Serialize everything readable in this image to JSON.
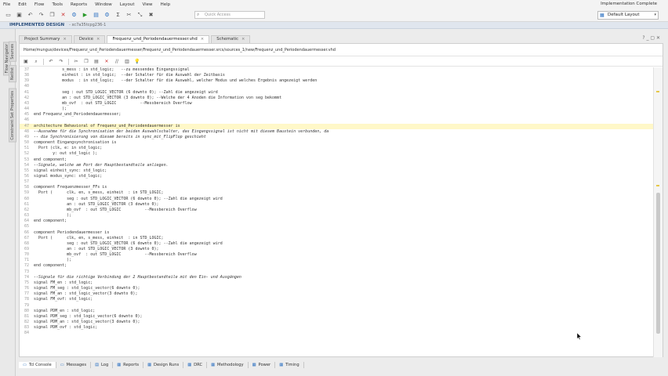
{
  "menu": {
    "items": [
      "File",
      "Edit",
      "Flow",
      "Tools",
      "Reports",
      "Window",
      "Layout",
      "View",
      "Help"
    ],
    "status": "Implementation Complete"
  },
  "toolbar": {
    "quick_access_placeholder": "Quick Access",
    "layout_value": "Default Layout"
  },
  "flow": {
    "title": "IMPLEMENTED DESIGN",
    "subtitle": "- xc7a35tcpg236-1"
  },
  "left_rail": {
    "tabs": [
      "Flow Navigator",
      "Sources",
      "Netlist",
      "Constraint Set Properties"
    ]
  },
  "editor_tabs": [
    {
      "label": "Project Summary",
      "active": false
    },
    {
      "label": "Device",
      "active": false
    },
    {
      "label": "Frequenz_und_Periodendauermesser.vhd",
      "active": true
    },
    {
      "label": "Schematic",
      "active": false
    }
  ],
  "editor": {
    "path": "Home/mungus/devices/Frequenz_und_Periodendauermesser/Frequenz_und_Periodendauermesser.srcs/sources_1/new/Frequenz_und_Periodendauermesser.vhd",
    "lines": [
      {
        "n": "37",
        "t": "            s_mess : in std_logic;   --zu messendes Eingangssignal",
        "hl": false
      },
      {
        "n": "38",
        "t": "            einheit : in std_logic;  --der Schalter für die Auswahl der Zeitbasis",
        "hl": false
      },
      {
        "n": "39",
        "t": "            modus  : in std_logic;   --der Schalter für die Auswahl, welcher Modus und welches Ergebnis angezeigt werden",
        "hl": false
      },
      {
        "n": "40",
        "t": "",
        "hl": false
      },
      {
        "n": "41",
        "t": "            seg : out STD_LOGIC_VECTOR (6 downto 0); --Zahl die angezeigt wird",
        "hl": false
      },
      {
        "n": "42",
        "t": "            an : out STD_LOGIC_VECTOR (3 downto 0); --Welche der 4 Anoden die Information von seg bekommt",
        "hl": false
      },
      {
        "n": "43",
        "t": "            mb_ovf  : out STD_LOGIC          --Messbereich Overflow",
        "hl": false
      },
      {
        "n": "44",
        "t": "            );",
        "hl": false
      },
      {
        "n": "45",
        "t": "end Frequenz_und_Periodendauermesser;",
        "hl": false
      },
      {
        "n": "46",
        "t": "",
        "hl": false
      },
      {
        "n": "47",
        "t": "architecture Behavioral of Frequenz_und_Periodendauermesser is",
        "hl": true
      },
      {
        "n": "48",
        "t": "--Ausnahme für die Synchronisation der beiden Auswahlschalter, das Eingangssignal ist nicht mit diesem Baustein verbunden, da",
        "hl": false
      },
      {
        "n": "49",
        "t": "-- die Synchronisierung von diesem bereits in sync_mit_FlipFlop geschieht",
        "hl": false
      },
      {
        "n": "50",
        "t": "component Eingangsynchronisation is",
        "hl": false
      },
      {
        "n": "51",
        "t": "  Port (clk, e: in std_logic;",
        "hl": false
      },
      {
        "n": "52",
        "t": "        y: out std_logic );",
        "hl": false
      },
      {
        "n": "53",
        "t": "end component;",
        "hl": false
      },
      {
        "n": "54",
        "t": "--Signale, welche am Port der Hauptbestandteile anliegen.",
        "hl": false
      },
      {
        "n": "55",
        "t": "signal einheit_sync: std_logic;",
        "hl": false
      },
      {
        "n": "56",
        "t": "signal modus_sync: std_logic;",
        "hl": false
      },
      {
        "n": "57",
        "t": "",
        "hl": false
      },
      {
        "n": "58",
        "t": "component Frequenzmesser_FFs is",
        "hl": false
      },
      {
        "n": "59",
        "t": "  Port (      clk, en, s_mess, einheit  : in STD_LOGIC;",
        "hl": false
      },
      {
        "n": "60",
        "t": "              seg : out STD_LOGIC_VECTOR (6 downto 0); --Zahl die angezeigt wird",
        "hl": false
      },
      {
        "n": "61",
        "t": "              an : out STD_LOGIC_VECTOR (3 downto 0);",
        "hl": false
      },
      {
        "n": "62",
        "t": "              mb_ovf  : out STD_LOGIC          --Messbereich Overflow",
        "hl": false
      },
      {
        "n": "63",
        "t": "              );",
        "hl": false
      },
      {
        "n": "64",
        "t": "end component;",
        "hl": false
      },
      {
        "n": "65",
        "t": "",
        "hl": false
      },
      {
        "n": "66",
        "t": "component Periodendauermesser is",
        "hl": false
      },
      {
        "n": "67",
        "t": "  Port (      clk, en, s_mess, einheit  : in STD_LOGIC;",
        "hl": false
      },
      {
        "n": "68",
        "t": "              seg : out STD_LOGIC_VECTOR (6 downto 0); --Zahl die angezeigt wird",
        "hl": false
      },
      {
        "n": "69",
        "t": "              an : out STD_LOGIC_VECTOR (3 downto 0);",
        "hl": false
      },
      {
        "n": "70",
        "t": "              mb_ovf  : out STD_LOGIC          --Messbereich Overflow",
        "hl": false
      },
      {
        "n": "71",
        "t": "              );",
        "hl": false
      },
      {
        "n": "72",
        "t": "end component;",
        "hl": false
      },
      {
        "n": "73",
        "t": "",
        "hl": false
      },
      {
        "n": "74",
        "t": "--Signale für die richtige Verbindung der 2 Hauptbestandteile mit den Ein- und Ausgängen",
        "hl": false
      },
      {
        "n": "75",
        "t": "signal FM_en : std_logic;",
        "hl": false
      },
      {
        "n": "76",
        "t": "signal FM_seg : std_logic_vector(6 downto 0);",
        "hl": false
      },
      {
        "n": "77",
        "t": "signal FM_an : std_logic_vector(3 downto 0);",
        "hl": false
      },
      {
        "n": "78",
        "t": "signal FM_ovf: std_logic;",
        "hl": false
      },
      {
        "n": "79",
        "t": "",
        "hl": false
      },
      {
        "n": "80",
        "t": "signal PDM_en : std_logic;",
        "hl": false
      },
      {
        "n": "81",
        "t": "signal PDM_seg : std_logic_vector(6 downto 0);",
        "hl": false
      },
      {
        "n": "82",
        "t": "signal PDM_an : std_logic_vector(3 downto 0);",
        "hl": false
      },
      {
        "n": "83",
        "t": "signal PDM_ovf : std_logic;",
        "hl": false
      },
      {
        "n": "84",
        "t": "",
        "hl": false
      }
    ]
  },
  "bottom_tabs": [
    "Tcl Console",
    "Messages",
    "Log",
    "Reports",
    "Design Runs",
    "DRC",
    "Methodology",
    "Power",
    "Timing"
  ]
}
